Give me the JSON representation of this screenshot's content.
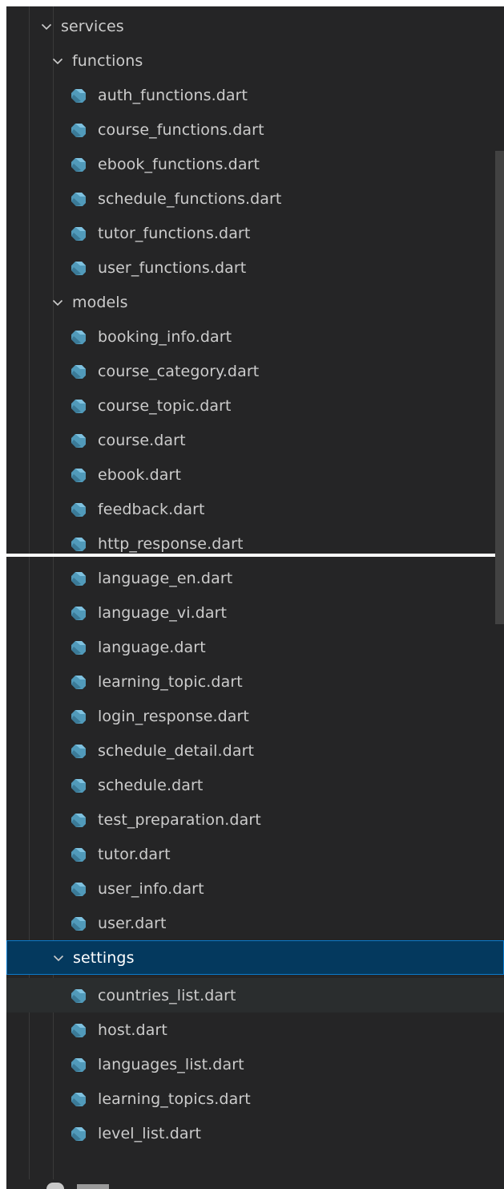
{
  "explorer": {
    "services": {
      "label": "services",
      "expanded": true
    },
    "functions": {
      "label": "functions",
      "files": [
        "auth_functions.dart",
        "course_functions.dart",
        "ebook_functions.dart",
        "schedule_functions.dart",
        "tutor_functions.dart",
        "user_functions.dart"
      ]
    },
    "models": {
      "label": "models",
      "files": [
        "booking_info.dart",
        "course_category.dart",
        "course_topic.dart",
        "course.dart",
        "ebook.dart",
        "feedback.dart",
        "http_response.dart",
        "language_en.dart",
        "language_vi.dart",
        "language.dart",
        "learning_topic.dart",
        "login_response.dart",
        "schedule_detail.dart",
        "schedule.dart",
        "test_preparation.dart",
        "tutor.dart",
        "user_info.dart",
        "user.dart"
      ]
    },
    "settings": {
      "label": "settings",
      "selected": true,
      "files": [
        "countries_list.dart",
        "host.dart",
        "languages_list.dart",
        "learning_topics.dart",
        "level_list.dart"
      ]
    }
  },
  "colors": {
    "sidebar_bg": "#252526",
    "text": "#cccccc",
    "selection_bg": "#04395e",
    "selection_border": "#0a7acc",
    "hover_bg": "#2a2d2e",
    "dart_icon": "#519aba",
    "scrollbar": "#424242"
  },
  "icons": {
    "folder_expanded": "chevron-down-icon",
    "file": "dart-file-icon"
  }
}
